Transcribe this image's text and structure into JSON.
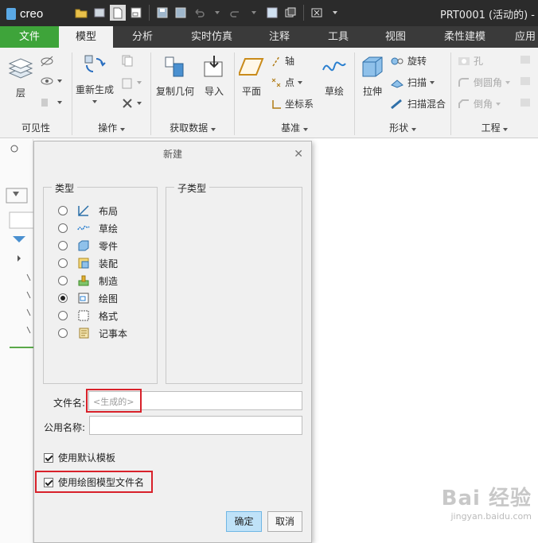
{
  "app": {
    "logo": "creo",
    "window_title": "PRT0001 (活动的) -"
  },
  "tabs": [
    "文件",
    "模型",
    "分析",
    "实时仿真",
    "注释",
    "工具",
    "视图",
    "柔性建模",
    "应用"
  ],
  "ribbon": {
    "groups": [
      "可见性",
      "操作",
      "获取数据",
      "基准",
      "形状",
      "工程"
    ],
    "layer": "层",
    "regenerate": "重新生成",
    "copy_geom": "复制几何",
    "import": "导入",
    "plane": "平面",
    "axis": "轴",
    "point": "点",
    "csys": "坐标系",
    "sketch": "草绘",
    "extrude": "拉伸",
    "revolve": "旋转",
    "sweep": "扫描",
    "swept_blend": "扫描混合",
    "hole": "孔",
    "round": "倒圆角",
    "chamfer": "倒角"
  },
  "dialog": {
    "title": "新建",
    "type_label": "类型",
    "subtype_label": "子类型",
    "types": [
      {
        "label": "布局",
        "selected": false,
        "icon": "layout-icon"
      },
      {
        "label": "草绘",
        "selected": false,
        "icon": "sketch-icon"
      },
      {
        "label": "零件",
        "selected": false,
        "icon": "part-icon"
      },
      {
        "label": "装配",
        "selected": false,
        "icon": "assembly-icon"
      },
      {
        "label": "制造",
        "selected": false,
        "icon": "manufacturing-icon"
      },
      {
        "label": "绘图",
        "selected": true,
        "icon": "drawing-icon"
      },
      {
        "label": "格式",
        "selected": false,
        "icon": "format-icon"
      },
      {
        "label": "记事本",
        "selected": false,
        "icon": "notebook-icon"
      }
    ],
    "filename_label": "文件名:",
    "filename_placeholder": "<生成的>",
    "common_name_label": "公用名称:",
    "common_name_value": "",
    "use_default_template": "使用默认模板",
    "use_drawing_model_filename": "使用绘图模型文件名",
    "use_default_template_checked": true,
    "use_drawing_model_filename_checked": true,
    "ok": "确定",
    "cancel": "取消"
  },
  "watermark": {
    "main": "Bai 经验",
    "sub": "jingyan.baidu.com"
  },
  "colors": {
    "file_tab": "#3ea43a",
    "titlebar": "#2b2b2b",
    "highlight": "#d8212a",
    "ok_button": "#bfe2f8"
  }
}
